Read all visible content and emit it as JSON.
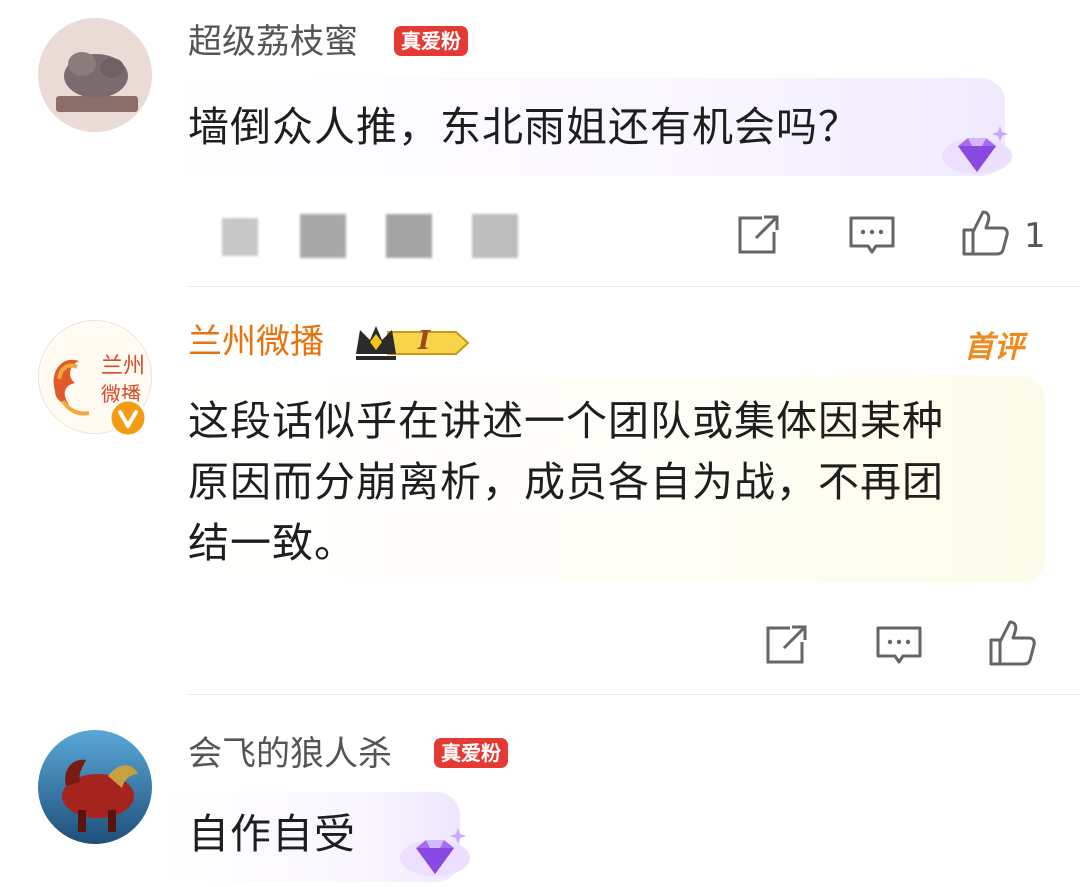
{
  "comments": [
    {
      "username": "超级荔枝蜜",
      "fan_badge": "真爱粉",
      "text": "墙倒众人推，东北雨姐还有机会吗？",
      "like_count": "1"
    },
    {
      "username": "兰州微播",
      "level_badge": "I",
      "first_comment_label": "首评",
      "avatar_text": "兰州微播",
      "text_lines": [
        "这段话似乎在讲述一个团队或集体因某种",
        "原因而分崩离析，成员各自为战，不再团",
        "结一致。"
      ]
    },
    {
      "username": "会飞的狼人杀",
      "fan_badge": "真爱粉",
      "text": "自作自受"
    }
  ],
  "colors": {
    "fan_badge_bg": "#e53935",
    "orange_username": "#e8730c",
    "icon_gray": "#666666"
  },
  "icons": [
    "share-icon",
    "comment-icon",
    "like-icon",
    "diamond-badge-icon",
    "crown-icon",
    "verified-icon"
  ]
}
